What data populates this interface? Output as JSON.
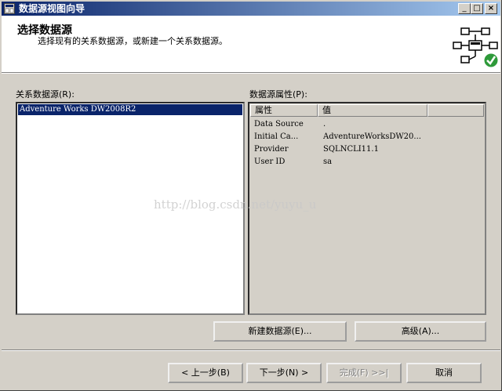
{
  "window": {
    "title": "数据源视图向导"
  },
  "titlebar_buttons": {
    "minimize": "_",
    "maximize": "□",
    "close": "×"
  },
  "header": {
    "title": "选择数据源",
    "subtitle": "选择现有的关系数据源，或新建一个关系数据源。"
  },
  "relational_sources": {
    "label": "关系数据源(R):",
    "items": [
      "Adventure Works DW2008R2"
    ],
    "selected_index": 0
  },
  "properties": {
    "label": "数据源属性(P):",
    "columns": [
      "属性",
      "值"
    ],
    "rows": [
      {
        "name": "Data Source",
        "value": "."
      },
      {
        "name": "Initial Ca...",
        "value": "AdventureWorksDW20..."
      },
      {
        "name": "Provider",
        "value": "SQLNCLI11.1"
      },
      {
        "name": "User ID",
        "value": "sa"
      }
    ]
  },
  "buttons": {
    "new_source": "新建数据源(E)...",
    "advanced": "高级(A)...",
    "back": "< 上一步(B)",
    "next": "下一步(N) >",
    "finish": "完成(F) >>|",
    "cancel": "取消"
  },
  "watermark": "http://blog.csdn.net/yuyu_u"
}
